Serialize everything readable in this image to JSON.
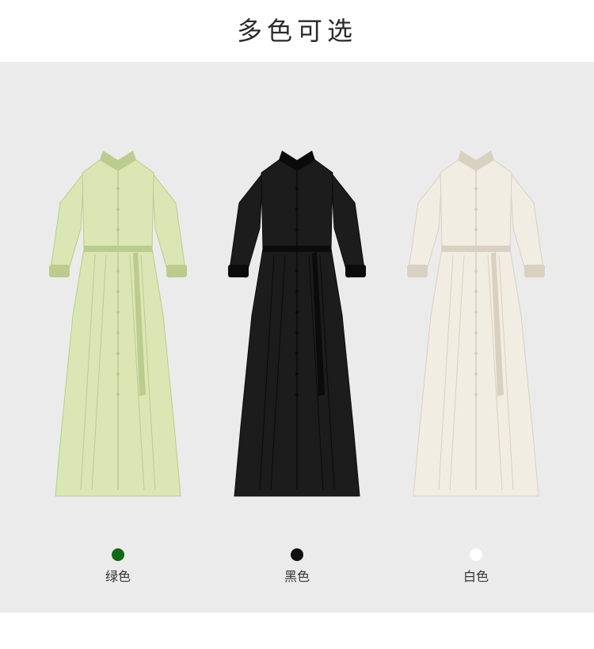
{
  "header": {
    "title": "多色可选"
  },
  "products": [
    {
      "label": "绿色",
      "swatch_color": "#116a11",
      "fabric_color": "#dbe6b4",
      "shade_color": "#bccb8e",
      "image": "light-green-shirt-dress"
    },
    {
      "label": "黑色",
      "swatch_color": "#111111",
      "fabric_color": "#1c1c1c",
      "shade_color": "#0b0b0b",
      "image": "black-shirt-dress"
    },
    {
      "label": "白色",
      "swatch_color": "#ffffff",
      "fabric_color": "#f2ede2",
      "shade_color": "#d8d0c1",
      "image": "off-white-shirt-dress"
    }
  ]
}
